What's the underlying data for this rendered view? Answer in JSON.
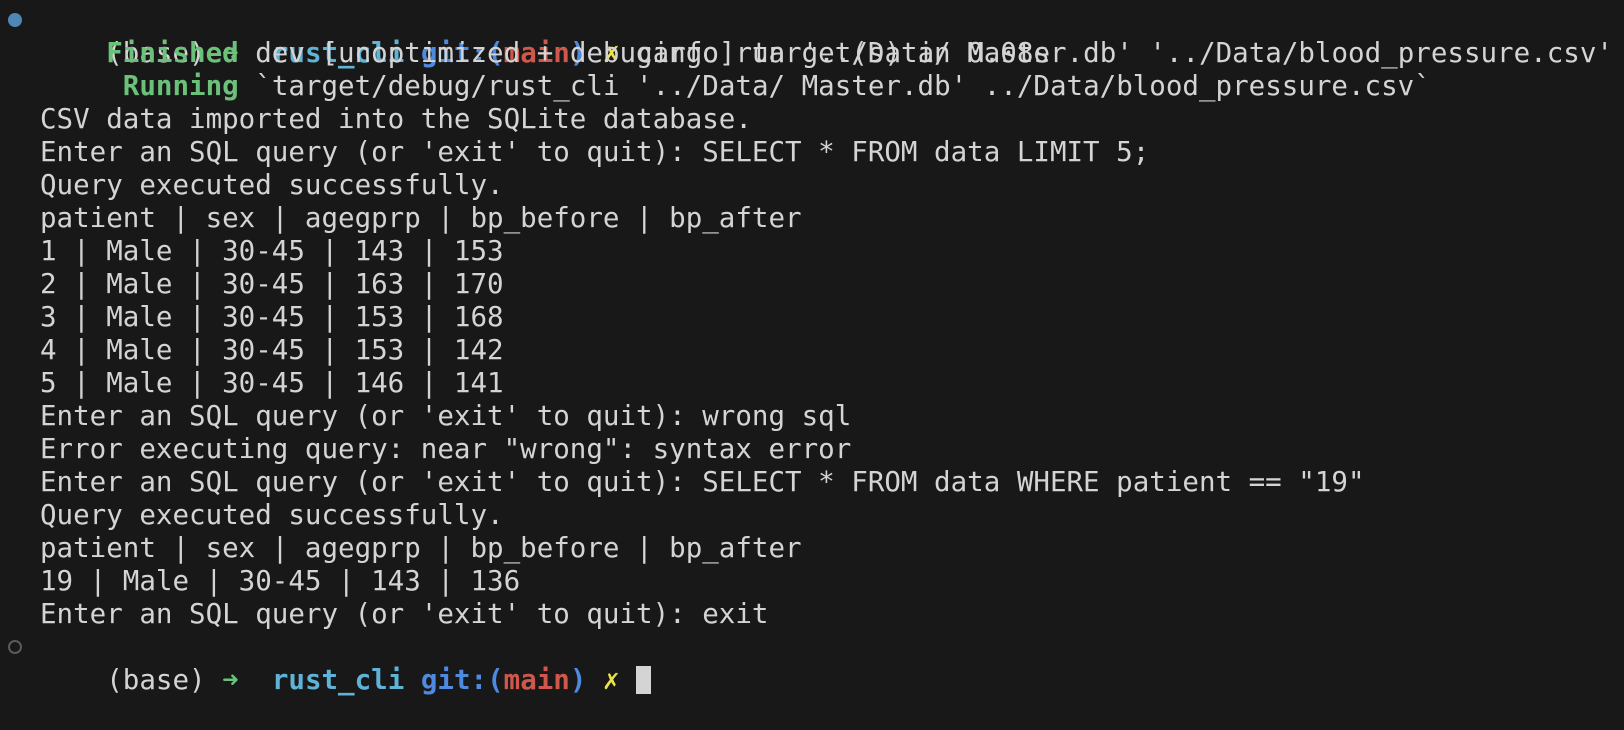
{
  "prompt": {
    "env": "(base)",
    "arrow": "➜",
    "dir": "rust_cli",
    "git_label": "git:(",
    "branch": "main",
    "git_close": ")",
    "dirty": "✗"
  },
  "command": "cargo run '../Data/ Master.db' '../Data/blood_pressure.csv'",
  "cargo": {
    "finished_label": "Finished",
    "finished_text": " dev [unoptimized + debuginfo] target(s) in 0.08s",
    "running_label": "Running",
    "running_text": " `target/debug/rust_cli '../Data/ Master.db' ../Data/blood_pressure.csv`"
  },
  "output": [
    "CSV data imported into the SQLite database.",
    "Enter an SQL query (or 'exit' to quit): SELECT * FROM data LIMIT 5;",
    "Query executed successfully.",
    "patient | sex | agegprp | bp_before | bp_after",
    "1 | Male | 30-45 | 143 | 153",
    "2 | Male | 30-45 | 163 | 170",
    "3 | Male | 30-45 | 153 | 168",
    "4 | Male | 30-45 | 153 | 142",
    "5 | Male | 30-45 | 146 | 141",
    "Enter an SQL query (or 'exit' to quit): wrong sql",
    "Error executing query: near \"wrong\": syntax error",
    "Enter an SQL query (or 'exit' to quit): SELECT * FROM data WHERE patient == \"19\"",
    "Query executed successfully.",
    "patient | sex | agegprp | bp_before | bp_after",
    "19 | Male | 30-45 | 143 | 136",
    "Enter an SQL query (or 'exit' to quit): exit"
  ],
  "colors": {
    "background": "#181818",
    "text": "#d4d4d4",
    "green": "#6cc17a",
    "cyan": "#5eb3d6",
    "blue": "#4d8ae0",
    "red": "#d0574b",
    "yellow": "#ece24a"
  }
}
